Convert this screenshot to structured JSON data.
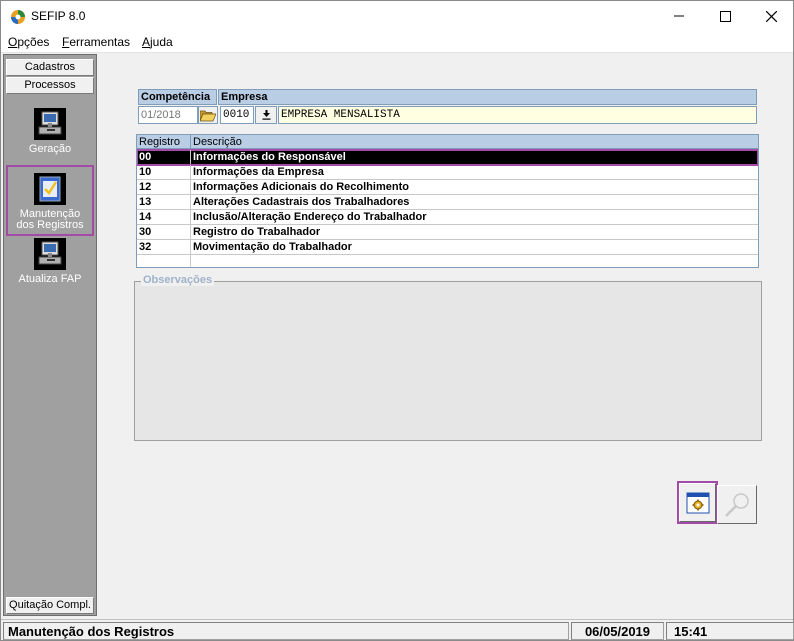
{
  "window": {
    "title": "SEFIP 8.0"
  },
  "menu": {
    "items": [
      {
        "first": "O",
        "rest": "pções"
      },
      {
        "first": "F",
        "rest": "erramentas"
      },
      {
        "first": "A",
        "rest": "juda"
      }
    ]
  },
  "sidebar": {
    "headers": [
      "Cadastros",
      "Processos"
    ],
    "items": [
      {
        "label": "Geração",
        "icon": "computer-disk-icon"
      },
      {
        "label_line1": "Manutenção",
        "label_line2": "dos Registros",
        "icon": "checklist-icon"
      },
      {
        "label": "Atualiza FAP",
        "icon": "computer-disk-icon"
      }
    ],
    "footer": "Quitação Compl."
  },
  "form": {
    "competencia_label": "Competência",
    "empresa_label": "Empresa",
    "competencia_value": "01/2018",
    "empresa_code": "0010",
    "empresa_name": "EMPRESA MENSALISTA"
  },
  "grid": {
    "columns": [
      "Registro",
      "Descrição"
    ],
    "rows": [
      {
        "registro": "00",
        "descricao": "Informações do Responsável"
      },
      {
        "registro": "10",
        "descricao": "Informações da Empresa"
      },
      {
        "registro": "12",
        "descricao": "Informações Adicionais do Recolhimento"
      },
      {
        "registro": "13",
        "descricao": "Alterações Cadastrais dos Trabalhadores"
      },
      {
        "registro": "14",
        "descricao": "Inclusão/Alteração Endereço do Trabalhador"
      },
      {
        "registro": "30",
        "descricao": "Registro do Trabalhador"
      },
      {
        "registro": "32",
        "descricao": "Movimentação do Trabalhador"
      }
    ],
    "selected_index": 0
  },
  "observacoes_label": "Observações",
  "statusbar": {
    "main": "Manutenção dos Registros",
    "date": "06/05/2019",
    "time": "15:41"
  },
  "colors": {
    "highlight": "#a44ba8",
    "grid_header": "#b9cde5",
    "sidebar": "#a0a0a0"
  }
}
